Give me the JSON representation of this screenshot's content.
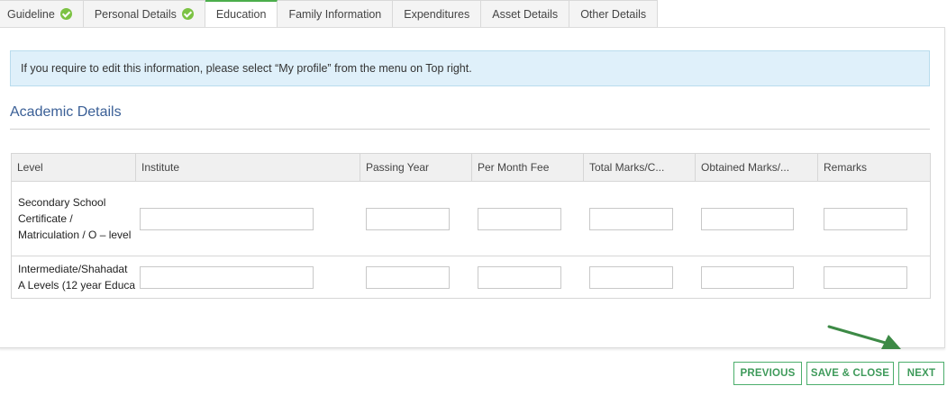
{
  "tabs": [
    {
      "label": "Guideline",
      "completed": true
    },
    {
      "label": "Personal Details",
      "completed": true
    },
    {
      "label": "Education",
      "active": true
    },
    {
      "label": "Family Information"
    },
    {
      "label": "Expenditures"
    },
    {
      "label": "Asset Details"
    },
    {
      "label": "Other Details"
    }
  ],
  "notice": "If you require to edit this information, please select “My profile” from the menu on Top right.",
  "section_title": "Academic Details",
  "table": {
    "headers": [
      "Level",
      "Institute",
      "Passing Year",
      "Per Month Fee",
      "Total Marks/C...",
      "Obtained Marks/...",
      "Remarks"
    ],
    "rows": [
      {
        "level": "Secondary School Certificate / Matriculation / O – level"
      },
      {
        "level": "Intermediate/Shahadat A Levels (12 year Educa"
      }
    ]
  },
  "buttons": {
    "previous": "PREVIOUS",
    "save_close": "SAVE & CLOSE",
    "next": "NEXT"
  },
  "colors": {
    "accent_green": "#4cae4c",
    "title_blue": "#3a5f96",
    "notice_bg": "#dff0fa",
    "arrow_green": "#3d8a46"
  }
}
